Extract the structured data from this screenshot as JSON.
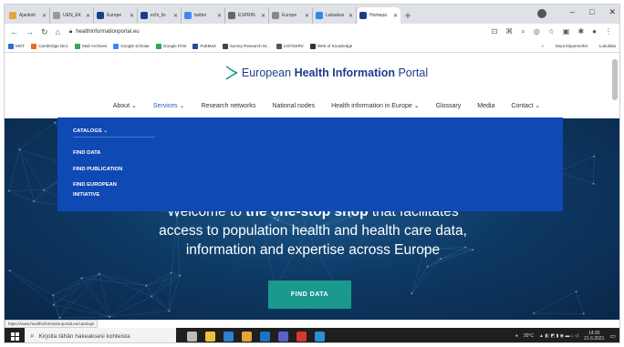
{
  "browser": {
    "tabs": [
      {
        "title": "Ajankoh",
        "color": "#e8a33d"
      },
      {
        "title": "UEN_EK",
        "color": "#9a9a9a"
      },
      {
        "title": "Europe",
        "color": "#1a3e8c"
      },
      {
        "title": "echi_lis",
        "color": "#1a3e8c"
      },
      {
        "title": "twitter",
        "color": "#4285f4"
      },
      {
        "title": "ESPRIN",
        "color": "#666666"
      },
      {
        "title": "Europe",
        "color": "#888888"
      },
      {
        "title": "Lataukse",
        "color": "#2f8ae6"
      },
      {
        "title": "Homepa",
        "color": "#1d3c8a"
      }
    ],
    "new_tab": "+",
    "window_controls": [
      "–",
      "□",
      "✕"
    ],
    "url": "healthinformationportal.eu",
    "bookmarks": [
      {
        "label": "MOT",
        "color": "#2f6fd0"
      },
      {
        "label": "Cambridge Dict.",
        "color": "#e86a1c"
      },
      {
        "label": "Mail Archives",
        "color": "#3aa55b"
      },
      {
        "label": "Google Scholar",
        "color": "#4285f4"
      },
      {
        "label": "Google Print",
        "color": "#34a853"
      },
      {
        "label": "PubMed",
        "color": "#1d4f91"
      },
      {
        "label": "Survey Research M...",
        "color": "#444444"
      },
      {
        "label": "LISTSERV",
        "color": "#555555"
      },
      {
        "label": "Web of Knowledge",
        "color": "#333333"
      }
    ],
    "bookmarks_more": "»",
    "other_bookmarks": "Muut kirjanmerkit",
    "reading_list": "Lukulista"
  },
  "site": {
    "logo_prefix": "European ",
    "logo_bold": "Health Information",
    "logo_suffix": " Portal",
    "nav": [
      "About ⌄",
      "Services ⌄",
      "Research networks",
      "National nodes",
      "Health information in Europe ⌄",
      "Glossary",
      "Media",
      "Contact ⌄"
    ],
    "dropdown": {
      "heading": "CATALOGS ⌄",
      "links": [
        "FIND DATA",
        "FIND PUBLICATION",
        "FIND EUROPEAN",
        "INITIATIVE"
      ]
    },
    "hero_line1_pre": "Welcome to ",
    "hero_line1_bold": "the one-stop shop",
    "hero_line1_post": " that facilitates",
    "hero_line2": "access to population health and health care data,",
    "hero_line3": "information and expertise across Europe",
    "cta": "FIND DATA"
  },
  "status_url": "https://www.healthinformationportal.eu/catalogs",
  "taskbar": {
    "search_placeholder": "Kirjoita tähän hakeaksesi kohteista",
    "apps": [
      {
        "name": "task-view",
        "color": "#bbbbbb"
      },
      {
        "name": "explorer",
        "color": "#f0c23a"
      },
      {
        "name": "store",
        "color": "#2f7fd0"
      },
      {
        "name": "chrome",
        "color": "#e8a33d"
      },
      {
        "name": "outlook",
        "color": "#1a73c8"
      },
      {
        "name": "teams",
        "color": "#5c5fc8"
      },
      {
        "name": "app",
        "color": "#d9372e"
      },
      {
        "name": "app2",
        "color": "#2b8fd6"
      }
    ],
    "weather": "30°C",
    "time": "14:30",
    "date": "21.6.2021"
  },
  "colors": {
    "dropdown_bg": "#0f49b4",
    "cta_bg": "#1a9a8f",
    "logo_blue": "#1d3c8a",
    "nav_active": "#2b5ec9"
  }
}
